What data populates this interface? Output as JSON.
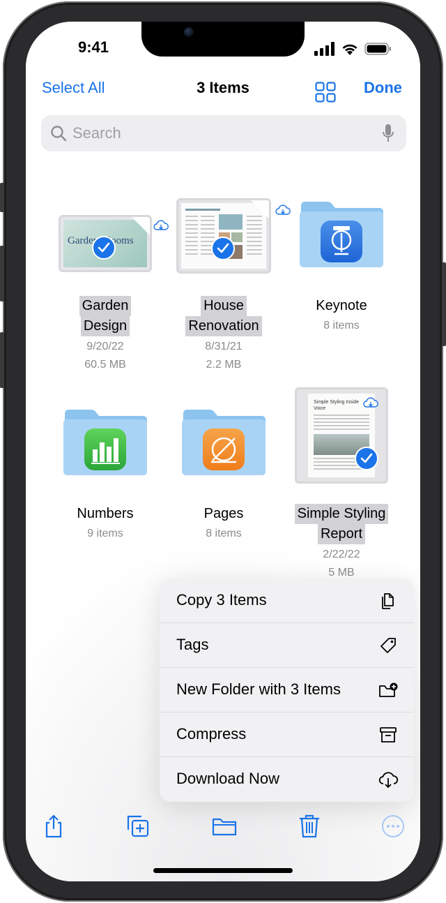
{
  "status_bar": {
    "time": "9:41"
  },
  "nav": {
    "select_all": "Select All",
    "title": "3 Items",
    "done": "Done"
  },
  "search": {
    "placeholder": "Search"
  },
  "items": [
    {
      "name_line1": "Garden",
      "name_line2": "Design",
      "date": "9/20/22",
      "size": "60.5 MB",
      "selected": true,
      "thumb_text": "Garden Blooms"
    },
    {
      "name_line1": "House",
      "name_line2": "Renovation",
      "date": "8/31/21",
      "size": "2.2 MB",
      "selected": true
    },
    {
      "name": "Keynote",
      "count": "8 items",
      "selected": false,
      "folder_app": "keynote-icon"
    },
    {
      "name": "Numbers",
      "count": "9 items",
      "selected": false,
      "folder_app": "numbers-icon"
    },
    {
      "name": "Pages",
      "count": "8 items",
      "selected": false,
      "folder_app": "pages-icon"
    },
    {
      "name_line1": "Simple Styling",
      "name_line2": "Report",
      "date": "2/22/22",
      "size": "5 MB",
      "selected": true,
      "thumb_text": "Simple Styling Inside Voice"
    }
  ],
  "context_menu": {
    "items": [
      {
        "label": "Copy 3 Items",
        "icon": "copy-icon"
      },
      {
        "label": "Tags",
        "icon": "tag-icon"
      },
      {
        "label": "New Folder with 3 Items",
        "icon": "folder-add-icon"
      },
      {
        "label": "Compress",
        "icon": "archive-icon"
      },
      {
        "label": "Download Now",
        "icon": "cloud-download-icon"
      }
    ]
  },
  "toolbar": {
    "icons": [
      "share-icon",
      "duplicate-icon",
      "move-folder-icon",
      "trash-icon",
      "more-icon"
    ]
  },
  "colors": {
    "accent": "#1a73e8",
    "folder": "#a9d3f5",
    "selection": "#d2d2d6"
  }
}
